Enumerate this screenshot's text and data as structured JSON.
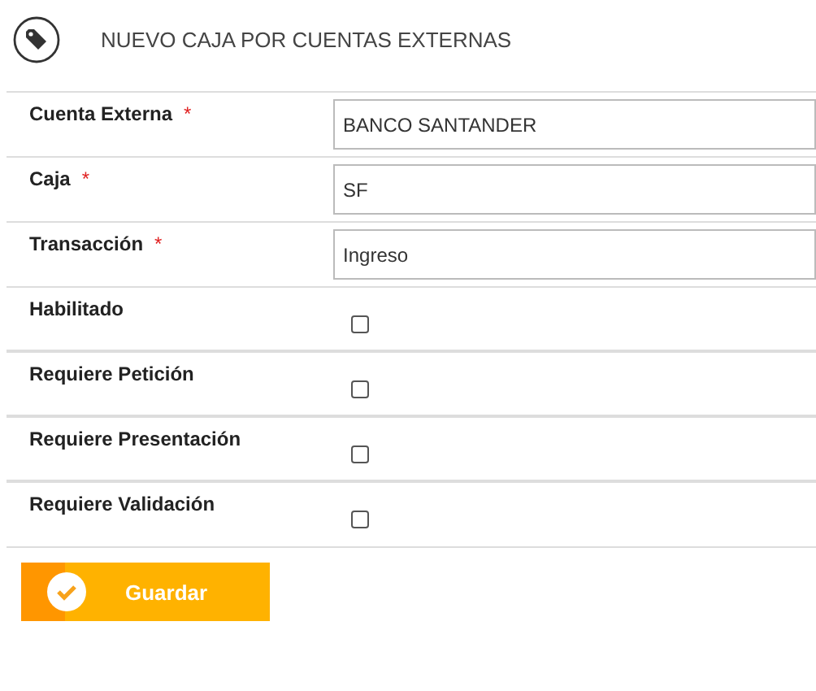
{
  "header": {
    "title": "NUEVO CAJA POR CUENTAS EXTERNAS"
  },
  "fields": [
    {
      "kind": "text",
      "label": "Cuenta Externa",
      "required_mark": "*",
      "value": "BANCO SANTANDER"
    },
    {
      "kind": "text",
      "label": "Caja",
      "required_mark": "*",
      "value": "SF"
    },
    {
      "kind": "text",
      "label": "Transacción",
      "required_mark": "*",
      "value": "Ingreso"
    },
    {
      "kind": "checkbox",
      "label": "Habilitado",
      "checked": false
    },
    {
      "kind": "checkbox",
      "label": "Requiere Petición",
      "checked": false
    },
    {
      "kind": "checkbox",
      "label": "Requiere Presentación",
      "checked": false
    },
    {
      "kind": "checkbox",
      "label": "Requiere Validación",
      "checked": false
    }
  ],
  "save_button": {
    "label": "Guardar"
  }
}
